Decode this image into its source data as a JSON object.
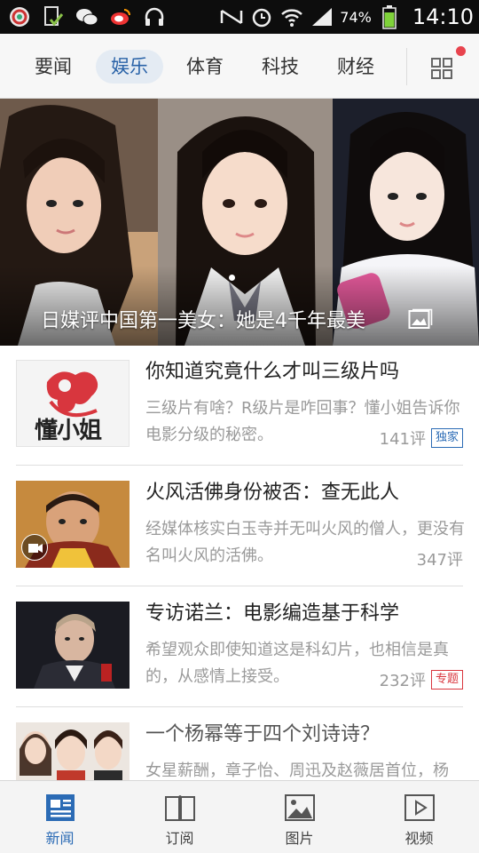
{
  "status_bar": {
    "icons": [
      "browser-icon",
      "download-check-icon",
      "wechat-icon",
      "weibo-icon",
      "headphones-icon"
    ],
    "right_icons": [
      "nfc-icon",
      "alarm-icon",
      "wifi-icon",
      "signal-icon"
    ],
    "battery_text": "74%",
    "time": "14:10"
  },
  "tabs": [
    {
      "label": "要闻"
    },
    {
      "label": "娱乐",
      "active": true
    },
    {
      "label": "体育"
    },
    {
      "label": "科技"
    },
    {
      "label": "财经"
    }
  ],
  "colors": {
    "accent": "#2b6bb5",
    "badge_blue": "#2b6bb5",
    "badge_red": "#d9363e",
    "notice_dot": "#e8444e"
  },
  "hero": {
    "title": "日媒评中国第一美女：她是4千年最美",
    "icon": "gallery-icon"
  },
  "news": [
    {
      "title": "你知道究竟什么才叫三级片吗",
      "desc": "三级片有啥？R级片是咋回事？懂小姐告诉你电影分级的秘密。",
      "count": "141评",
      "badge": "独家",
      "thumb_text": "懂小姐"
    },
    {
      "title": "火风活佛身份被否：查无此人",
      "desc": "经媒体核实白玉寺并无叫火风的僧人，更没有名叫火风的活佛。",
      "count": "347评",
      "badge": "",
      "thumb_icon": "video-icon"
    },
    {
      "title": "专访诺兰：电影编造基于科学",
      "desc": "希望观众即使知道这是科幻片，也相信是真的，从感情上接受。",
      "count": "232评",
      "badge": "专题"
    },
    {
      "title": "一个杨幂等于四个刘诗诗？",
      "desc": "女星薪酬，章子怡、周迅及赵薇居首位，杨",
      "count": "",
      "badge": ""
    }
  ],
  "bottom_nav": [
    {
      "label": "新闻",
      "icon": "news-icon",
      "active": true
    },
    {
      "label": "订阅",
      "icon": "book-icon"
    },
    {
      "label": "图片",
      "icon": "picture-icon"
    },
    {
      "label": "视频",
      "icon": "play-icon"
    }
  ]
}
